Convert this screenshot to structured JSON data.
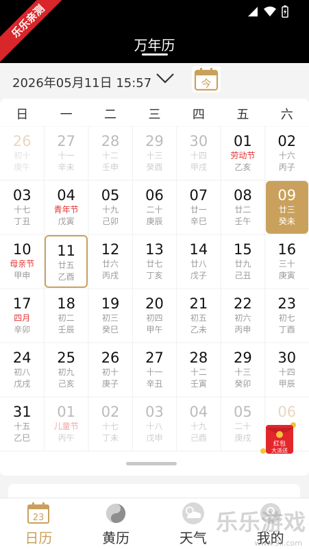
{
  "ribbon": "乐乐亲测",
  "app_title": "万年历",
  "datetime": "2026年05月11日 15:57",
  "today_button_label": "今",
  "weekdays": [
    "日",
    "一",
    "二",
    "三",
    "四",
    "五",
    "六"
  ],
  "days": [
    {
      "d": "26",
      "l1": "初十",
      "l2": "庚午",
      "state": "veryDim"
    },
    {
      "d": "27",
      "l1": "十一",
      "l2": "辛未",
      "state": "dim"
    },
    {
      "d": "28",
      "l1": "十二",
      "l2": "壬申",
      "state": "dim"
    },
    {
      "d": "29",
      "l1": "十三",
      "l2": "癸酉",
      "state": "dim"
    },
    {
      "d": "30",
      "l1": "十四",
      "l2": "甲戌",
      "state": "dim"
    },
    {
      "d": "01",
      "l1": "劳动节",
      "l2": "乙亥",
      "state": "",
      "red": true
    },
    {
      "d": "02",
      "l1": "十六",
      "l2": "丙子",
      "state": ""
    },
    {
      "d": "03",
      "l1": "十七",
      "l2": "丁丑",
      "state": ""
    },
    {
      "d": "04",
      "l1": "青年节",
      "l2": "戊寅",
      "state": "",
      "red": true
    },
    {
      "d": "05",
      "l1": "十九",
      "l2": "己卯",
      "state": ""
    },
    {
      "d": "06",
      "l1": "二十",
      "l2": "庚辰",
      "state": ""
    },
    {
      "d": "07",
      "l1": "廿一",
      "l2": "辛巳",
      "state": ""
    },
    {
      "d": "08",
      "l1": "廿二",
      "l2": "壬午",
      "state": ""
    },
    {
      "d": "09",
      "l1": "廿三",
      "l2": "癸未",
      "state": "selected"
    },
    {
      "d": "10",
      "l1": "母亲节",
      "l2": "甲申",
      "state": "",
      "red": true
    },
    {
      "d": "11",
      "l1": "廿五",
      "l2": "乙酉",
      "state": "today"
    },
    {
      "d": "12",
      "l1": "廿六",
      "l2": "丙戌",
      "state": ""
    },
    {
      "d": "13",
      "l1": "廿七",
      "l2": "丁亥",
      "state": ""
    },
    {
      "d": "14",
      "l1": "廿八",
      "l2": "戊子",
      "state": ""
    },
    {
      "d": "15",
      "l1": "廿九",
      "l2": "己丑",
      "state": ""
    },
    {
      "d": "16",
      "l1": "三十",
      "l2": "庚寅",
      "state": ""
    },
    {
      "d": "17",
      "l1": "四月",
      "l2": "辛卯",
      "state": "",
      "red": true
    },
    {
      "d": "18",
      "l1": "初二",
      "l2": "壬辰",
      "state": ""
    },
    {
      "d": "19",
      "l1": "初三",
      "l2": "癸巳",
      "state": ""
    },
    {
      "d": "20",
      "l1": "初四",
      "l2": "甲午",
      "state": ""
    },
    {
      "d": "21",
      "l1": "初五",
      "l2": "乙未",
      "state": ""
    },
    {
      "d": "22",
      "l1": "初六",
      "l2": "丙申",
      "state": ""
    },
    {
      "d": "23",
      "l1": "初七",
      "l2": "丁酉",
      "state": ""
    },
    {
      "d": "24",
      "l1": "初八",
      "l2": "戊戌",
      "state": ""
    },
    {
      "d": "25",
      "l1": "初九",
      "l2": "己亥",
      "state": ""
    },
    {
      "d": "26",
      "l1": "初十",
      "l2": "庚子",
      "state": ""
    },
    {
      "d": "27",
      "l1": "十一",
      "l2": "辛丑",
      "state": ""
    },
    {
      "d": "28",
      "l1": "十二",
      "l2": "壬寅",
      "state": ""
    },
    {
      "d": "29",
      "l1": "十三",
      "l2": "癸卯",
      "state": ""
    },
    {
      "d": "30",
      "l1": "十四",
      "l2": "甲辰",
      "state": ""
    },
    {
      "d": "31",
      "l1": "十五",
      "l2": "乙巳",
      "state": ""
    },
    {
      "d": "01",
      "l1": "儿童节",
      "l2": "丙午",
      "state": "dim",
      "red": true
    },
    {
      "d": "02",
      "l1": "十七",
      "l2": "丁未",
      "state": "dim"
    },
    {
      "d": "03",
      "l1": "十八",
      "l2": "戊申",
      "state": "dim"
    },
    {
      "d": "04",
      "l1": "十九",
      "l2": "己酉",
      "state": "dim"
    },
    {
      "d": "05",
      "l1": "二十",
      "l2": "庚戌",
      "state": "dim"
    },
    {
      "d": "06",
      "l1": "",
      "l2": "",
      "state": "veryDim"
    }
  ],
  "promo": {
    "line1": "红包",
    "line2": "大派送"
  },
  "tabs": [
    {
      "label": "日历",
      "icon": "calendar-icon",
      "active": true
    },
    {
      "label": "黄历",
      "icon": "yinyang-icon",
      "active": false
    },
    {
      "label": "天气",
      "icon": "weather-icon",
      "active": false
    },
    {
      "label": "我的",
      "icon": "user-icon",
      "active": false
    }
  ],
  "calendar_icon_number": "23",
  "watermark": "乐乐游戏",
  "watermark_url": "www.9ll.com",
  "colors": {
    "accent": "#c9a15c",
    "festival_red": "#e23333",
    "topbar": "#000000"
  }
}
